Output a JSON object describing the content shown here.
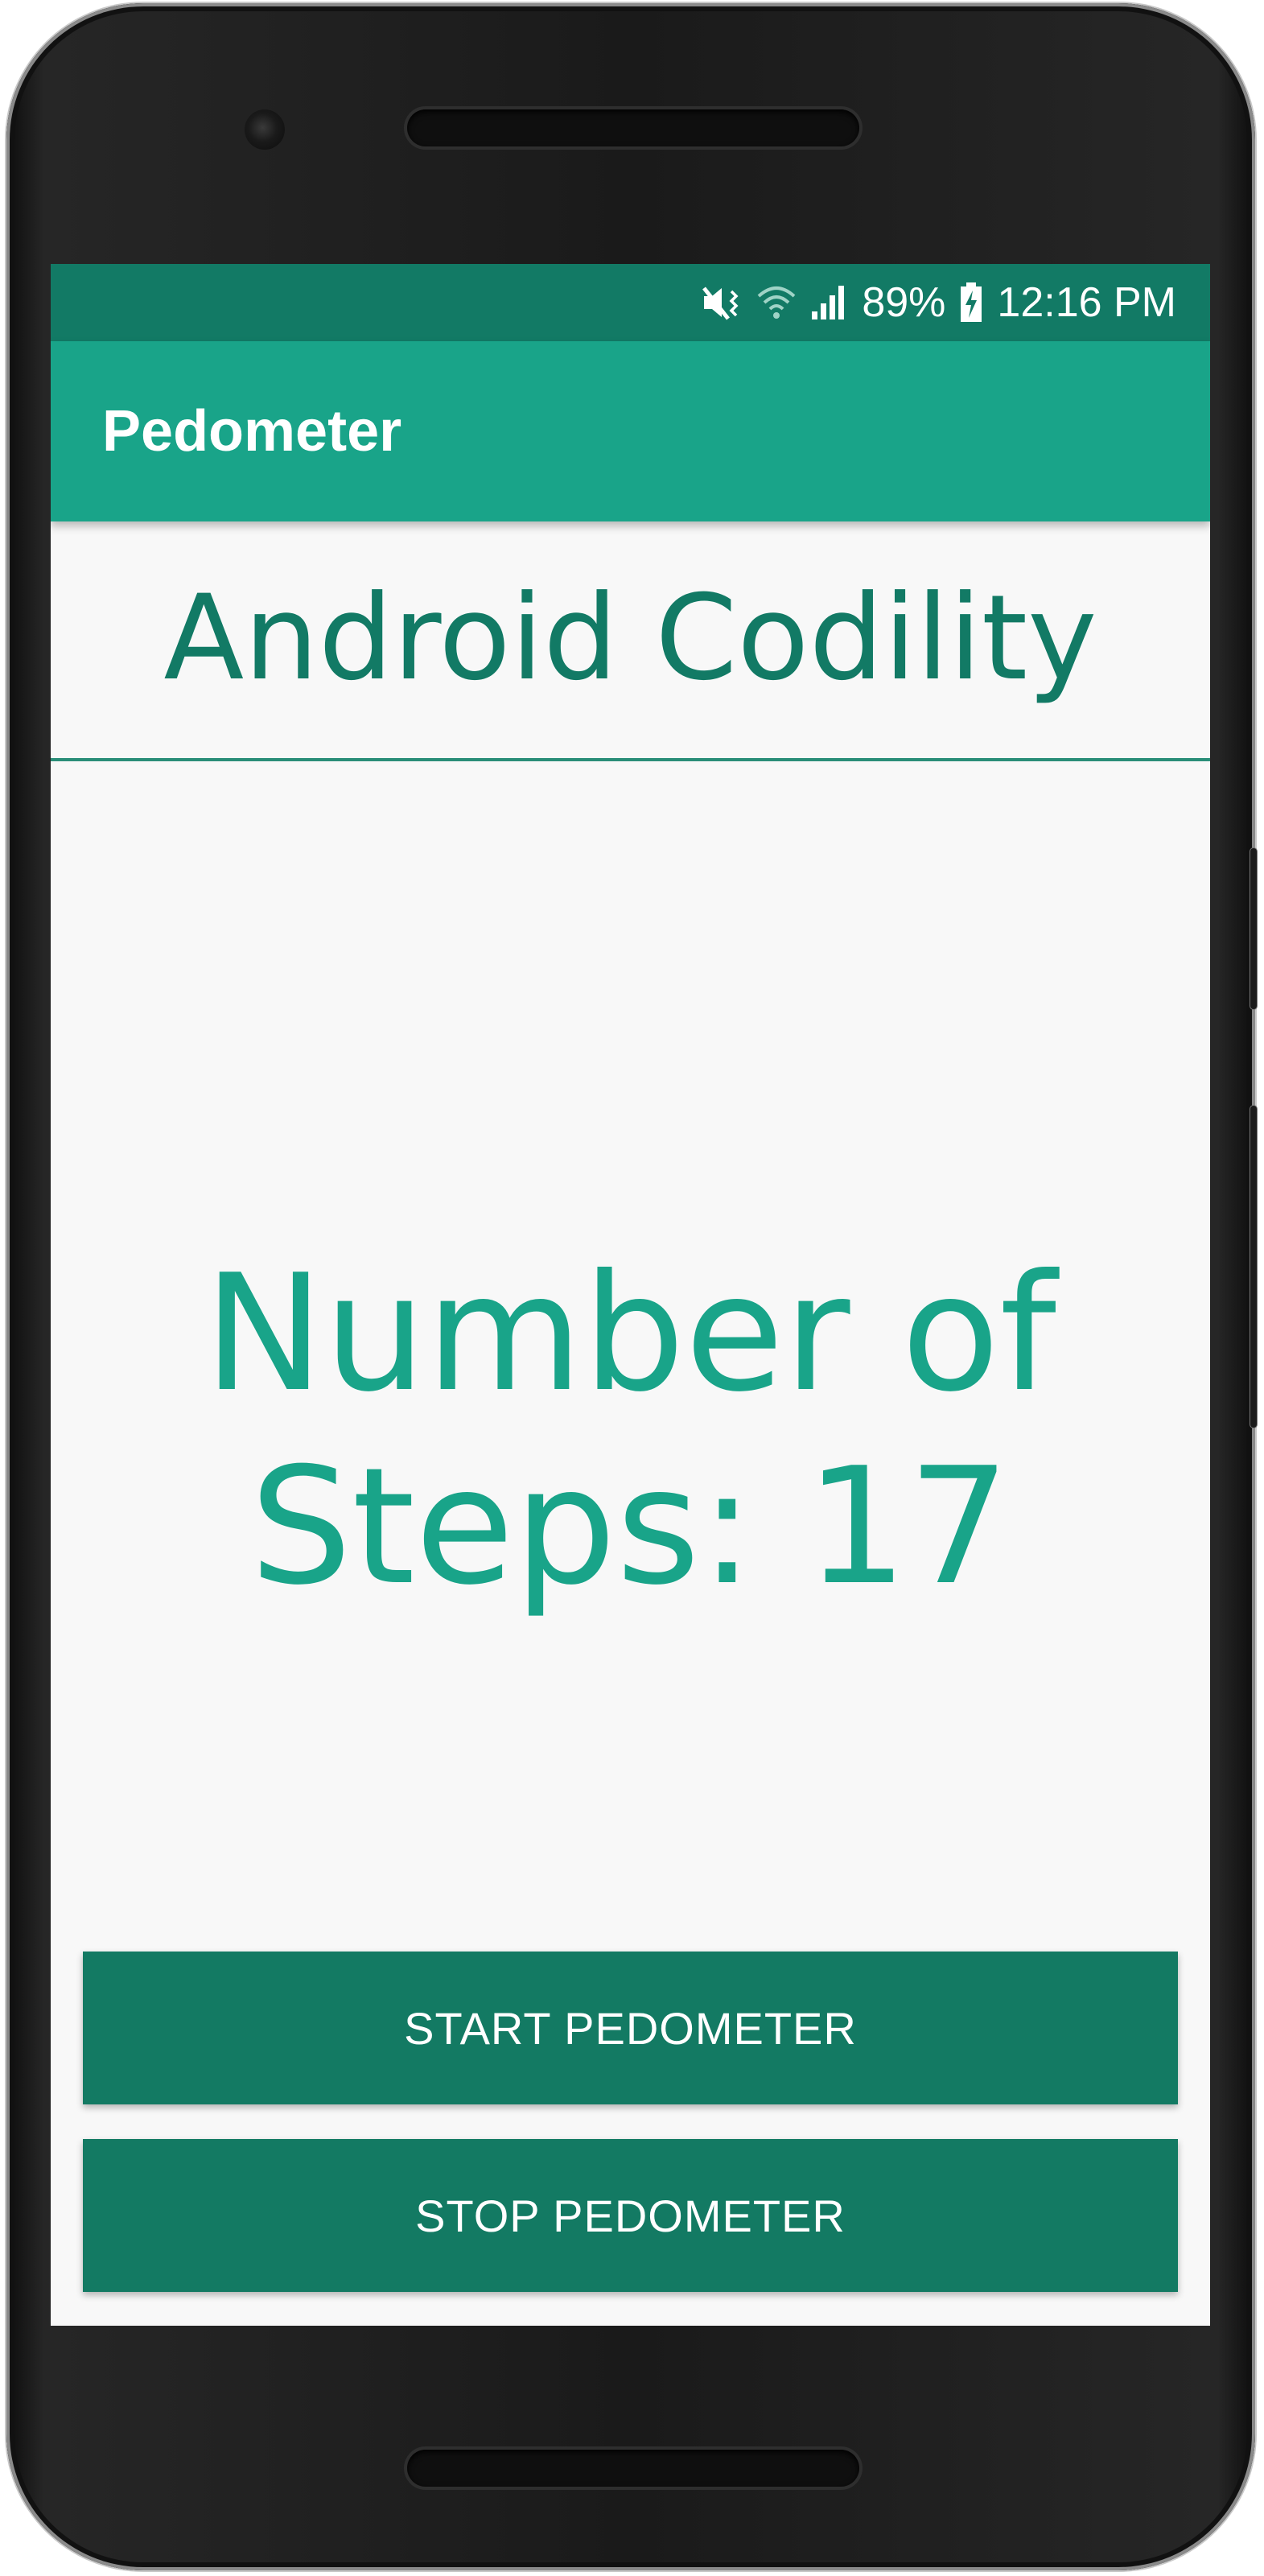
{
  "status_bar": {
    "battery_percent": "89%",
    "time": "12:16 PM",
    "icons": [
      "mute-vibrate-icon",
      "wifi-icon",
      "signal-icon",
      "battery-charging-icon"
    ]
  },
  "app_bar": {
    "title": "Pedometer"
  },
  "main": {
    "header": "Android Codility",
    "steps_line1": "Number of",
    "steps_line2": "Steps: 17"
  },
  "buttons": {
    "start_label": "START PEDOMETER",
    "stop_label": "STOP PEDOMETER"
  },
  "colors": {
    "status_bar": "#127a65",
    "app_bar": "#19a489",
    "button": "#137a63",
    "steps_text": "#19a489",
    "header_text": "#127a65"
  }
}
